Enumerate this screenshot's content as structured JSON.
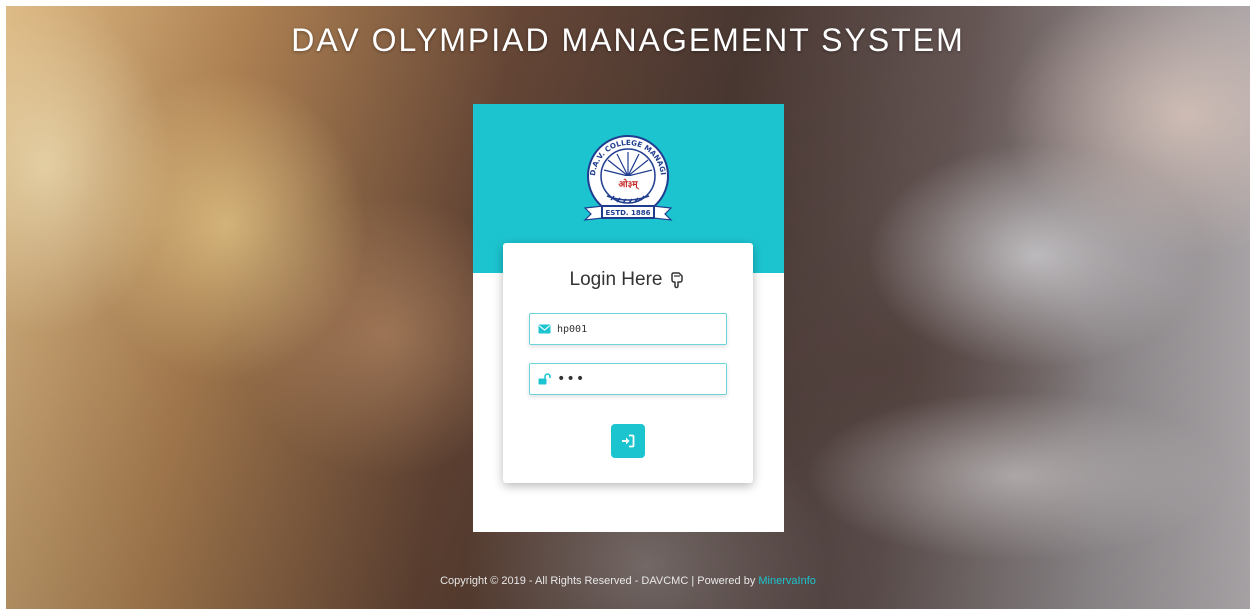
{
  "header": {
    "title": "DAV OLYMPIAD MANAGEMENT SYSTEM"
  },
  "logo": {
    "arc_text": "D.A.V. COLLEGE MANAGING COMMITTEE",
    "center_text": "ओ३म्",
    "ribbon_text": "ESTD. 1886"
  },
  "login": {
    "heading": "Login Here",
    "username_value": "hp001",
    "password_value": "•••",
    "submit_icon": "sign-in-icon"
  },
  "footer": {
    "copyright": "Copyright © 2019 - All Rights Reserved - DAVCMC | Powered by",
    "powered_link": "MinervaInfo"
  },
  "colors": {
    "accent": "#1cc4cf",
    "logo_blue": "#1f3c8f"
  }
}
